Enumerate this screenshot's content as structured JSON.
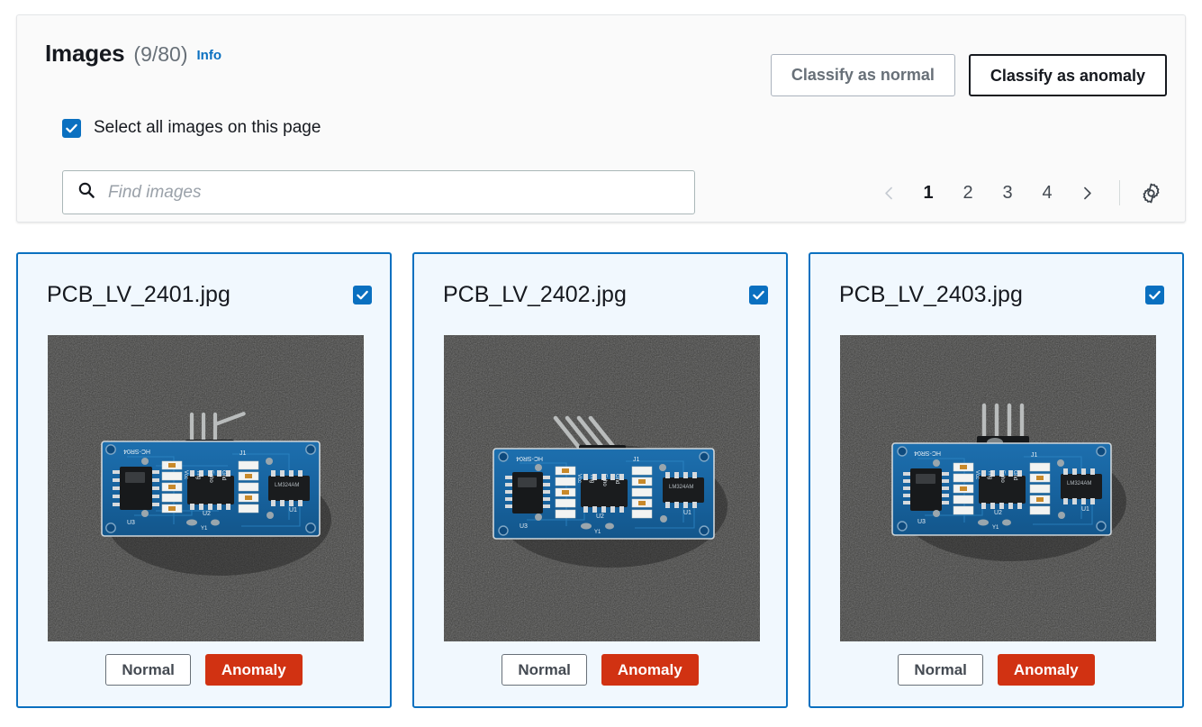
{
  "header": {
    "title": "Images",
    "count": "(9/80)",
    "info_label": "Info",
    "select_all_label": "Select all images on this page",
    "select_all_checked": true,
    "classify_normal_label": "Classify as normal",
    "classify_anomaly_label": "Classify as anomaly"
  },
  "search": {
    "placeholder": "Find images",
    "value": "",
    "icon": "search-icon"
  },
  "pagination": {
    "prev_icon": "chevron-left-icon",
    "next_icon": "chevron-right-icon",
    "prev_disabled": true,
    "pages": [
      "1",
      "2",
      "3",
      "4"
    ],
    "current_page": "1",
    "settings_icon": "gear-icon"
  },
  "colors": {
    "accent_blue": "#0a70c0",
    "anomaly_red": "#d13212",
    "card_background": "#f1f8fe",
    "panel_background": "#fafafa",
    "text_primary": "#16191f",
    "text_secondary": "#687078"
  },
  "cards": [
    {
      "filename": "PCB_LV_2401.jpg",
      "checked": true,
      "normal_label": "Normal",
      "anomaly_label": "Anomaly",
      "selected_label": "Anomaly",
      "image_alt": "pcb-hc-sr04-board-photo",
      "pin_style": "straight-with-bent-lead"
    },
    {
      "filename": "PCB_LV_2402.jpg",
      "checked": true,
      "normal_label": "Normal",
      "anomaly_label": "Anomaly",
      "selected_label": "Anomaly",
      "image_alt": "pcb-hc-sr04-board-photo",
      "pin_style": "bent-pins"
    },
    {
      "filename": "PCB_LV_2403.jpg",
      "checked": true,
      "normal_label": "Normal",
      "anomaly_label": "Anomaly",
      "selected_label": "Anomaly",
      "image_alt": "pcb-hc-sr04-board-photo",
      "pin_style": "straight-pins-with-connector"
    }
  ],
  "pcb_labels": {
    "silk_top": "HC-SR04",
    "pins": [
      "Vcc",
      "Trig",
      "Echo",
      "Gnd"
    ],
    "j1": "J1",
    "u1": "U1",
    "u2": "U2",
    "u3": "U3",
    "y1": "Y1",
    "ic_text": "LM324AM"
  }
}
